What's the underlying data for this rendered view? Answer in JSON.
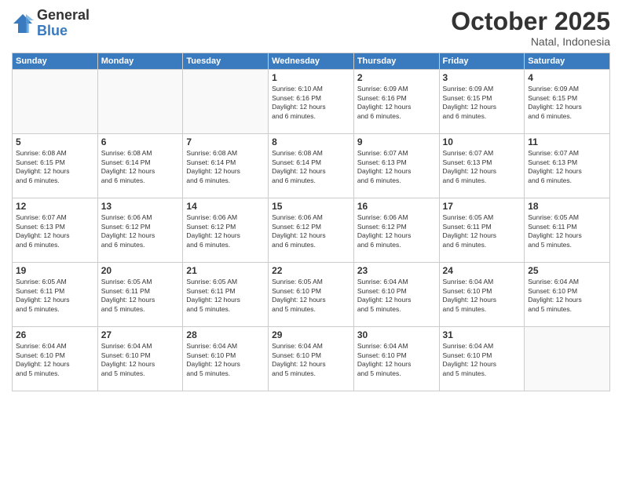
{
  "logo": {
    "general": "General",
    "blue": "Blue"
  },
  "header": {
    "month": "October 2025",
    "location": "Natal, Indonesia"
  },
  "days_header": [
    "Sunday",
    "Monday",
    "Tuesday",
    "Wednesday",
    "Thursday",
    "Friday",
    "Saturday"
  ],
  "weeks": [
    [
      {
        "day": "",
        "info": ""
      },
      {
        "day": "",
        "info": ""
      },
      {
        "day": "",
        "info": ""
      },
      {
        "day": "1",
        "info": "Sunrise: 6:10 AM\nSunset: 6:16 PM\nDaylight: 12 hours\nand 6 minutes."
      },
      {
        "day": "2",
        "info": "Sunrise: 6:09 AM\nSunset: 6:16 PM\nDaylight: 12 hours\nand 6 minutes."
      },
      {
        "day": "3",
        "info": "Sunrise: 6:09 AM\nSunset: 6:15 PM\nDaylight: 12 hours\nand 6 minutes."
      },
      {
        "day": "4",
        "info": "Sunrise: 6:09 AM\nSunset: 6:15 PM\nDaylight: 12 hours\nand 6 minutes."
      }
    ],
    [
      {
        "day": "5",
        "info": "Sunrise: 6:08 AM\nSunset: 6:15 PM\nDaylight: 12 hours\nand 6 minutes."
      },
      {
        "day": "6",
        "info": "Sunrise: 6:08 AM\nSunset: 6:14 PM\nDaylight: 12 hours\nand 6 minutes."
      },
      {
        "day": "7",
        "info": "Sunrise: 6:08 AM\nSunset: 6:14 PM\nDaylight: 12 hours\nand 6 minutes."
      },
      {
        "day": "8",
        "info": "Sunrise: 6:08 AM\nSunset: 6:14 PM\nDaylight: 12 hours\nand 6 minutes."
      },
      {
        "day": "9",
        "info": "Sunrise: 6:07 AM\nSunset: 6:13 PM\nDaylight: 12 hours\nand 6 minutes."
      },
      {
        "day": "10",
        "info": "Sunrise: 6:07 AM\nSunset: 6:13 PM\nDaylight: 12 hours\nand 6 minutes."
      },
      {
        "day": "11",
        "info": "Sunrise: 6:07 AM\nSunset: 6:13 PM\nDaylight: 12 hours\nand 6 minutes."
      }
    ],
    [
      {
        "day": "12",
        "info": "Sunrise: 6:07 AM\nSunset: 6:13 PM\nDaylight: 12 hours\nand 6 minutes."
      },
      {
        "day": "13",
        "info": "Sunrise: 6:06 AM\nSunset: 6:12 PM\nDaylight: 12 hours\nand 6 minutes."
      },
      {
        "day": "14",
        "info": "Sunrise: 6:06 AM\nSunset: 6:12 PM\nDaylight: 12 hours\nand 6 minutes."
      },
      {
        "day": "15",
        "info": "Sunrise: 6:06 AM\nSunset: 6:12 PM\nDaylight: 12 hours\nand 6 minutes."
      },
      {
        "day": "16",
        "info": "Sunrise: 6:06 AM\nSunset: 6:12 PM\nDaylight: 12 hours\nand 6 minutes."
      },
      {
        "day": "17",
        "info": "Sunrise: 6:05 AM\nSunset: 6:11 PM\nDaylight: 12 hours\nand 6 minutes."
      },
      {
        "day": "18",
        "info": "Sunrise: 6:05 AM\nSunset: 6:11 PM\nDaylight: 12 hours\nand 5 minutes."
      }
    ],
    [
      {
        "day": "19",
        "info": "Sunrise: 6:05 AM\nSunset: 6:11 PM\nDaylight: 12 hours\nand 5 minutes."
      },
      {
        "day": "20",
        "info": "Sunrise: 6:05 AM\nSunset: 6:11 PM\nDaylight: 12 hours\nand 5 minutes."
      },
      {
        "day": "21",
        "info": "Sunrise: 6:05 AM\nSunset: 6:11 PM\nDaylight: 12 hours\nand 5 minutes."
      },
      {
        "day": "22",
        "info": "Sunrise: 6:05 AM\nSunset: 6:10 PM\nDaylight: 12 hours\nand 5 minutes."
      },
      {
        "day": "23",
        "info": "Sunrise: 6:04 AM\nSunset: 6:10 PM\nDaylight: 12 hours\nand 5 minutes."
      },
      {
        "day": "24",
        "info": "Sunrise: 6:04 AM\nSunset: 6:10 PM\nDaylight: 12 hours\nand 5 minutes."
      },
      {
        "day": "25",
        "info": "Sunrise: 6:04 AM\nSunset: 6:10 PM\nDaylight: 12 hours\nand 5 minutes."
      }
    ],
    [
      {
        "day": "26",
        "info": "Sunrise: 6:04 AM\nSunset: 6:10 PM\nDaylight: 12 hours\nand 5 minutes."
      },
      {
        "day": "27",
        "info": "Sunrise: 6:04 AM\nSunset: 6:10 PM\nDaylight: 12 hours\nand 5 minutes."
      },
      {
        "day": "28",
        "info": "Sunrise: 6:04 AM\nSunset: 6:10 PM\nDaylight: 12 hours\nand 5 minutes."
      },
      {
        "day": "29",
        "info": "Sunrise: 6:04 AM\nSunset: 6:10 PM\nDaylight: 12 hours\nand 5 minutes."
      },
      {
        "day": "30",
        "info": "Sunrise: 6:04 AM\nSunset: 6:10 PM\nDaylight: 12 hours\nand 5 minutes."
      },
      {
        "day": "31",
        "info": "Sunrise: 6:04 AM\nSunset: 6:10 PM\nDaylight: 12 hours\nand 5 minutes."
      },
      {
        "day": "",
        "info": ""
      }
    ]
  ]
}
